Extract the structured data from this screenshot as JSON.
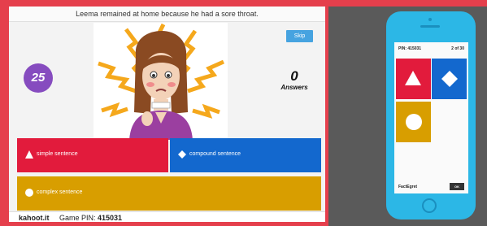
{
  "question": {
    "text": "Leema remained at home because he had a sore throat."
  },
  "timer": {
    "value": "25"
  },
  "skip": {
    "label": "Skip"
  },
  "answers_counter": {
    "count": "0",
    "label": "Answers"
  },
  "choices": [
    {
      "icon": "triangle-icon",
      "text": "simple sentence",
      "color": "#e21b3c"
    },
    {
      "icon": "diamond-icon",
      "text": "compound sentence",
      "color": "#1368ce"
    },
    {
      "icon": "circle-icon",
      "text": "complex sentence",
      "color": "#d89e00"
    }
  ],
  "footer": {
    "site": "kahoot.it",
    "pin_label": "Game PIN:",
    "pin_value": "415031"
  },
  "phone": {
    "pin": "PIN: 415031",
    "progress": "2 of 30",
    "nickname": "FactEgret",
    "button": "OK",
    "tiles": [
      "triangle-icon",
      "diamond-icon",
      "circle-icon"
    ],
    "tile_colors": [
      "#e21b3c",
      "#1368ce",
      "#d89e00"
    ]
  },
  "colors": {
    "frame": "#e53f4c",
    "timer": "#864cbf",
    "skip": "#46a3e0",
    "phone_body": "#2cb7e6"
  }
}
